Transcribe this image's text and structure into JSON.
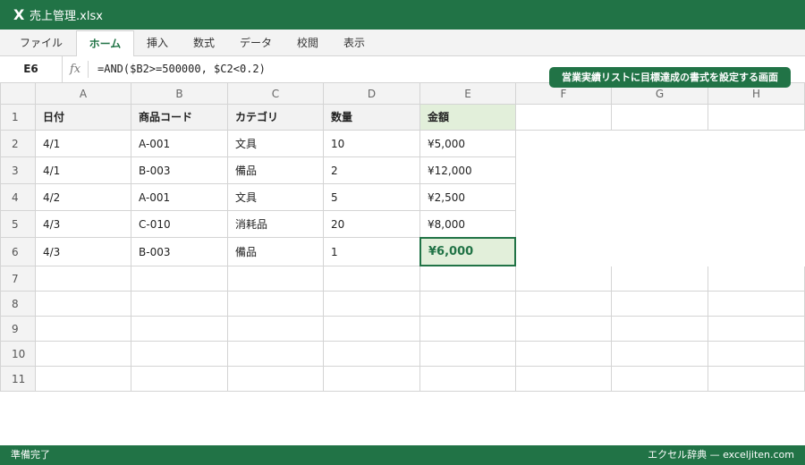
{
  "window": {
    "app_icon": "X",
    "title": "売上管理.xlsx"
  },
  "ribbon": {
    "tabs": [
      {
        "label": "ファイル",
        "active": false
      },
      {
        "label": "ホーム",
        "active": true
      },
      {
        "label": "挿入",
        "active": false
      },
      {
        "label": "数式",
        "active": false
      },
      {
        "label": "データ",
        "active": false
      },
      {
        "label": "校閲",
        "active": false
      },
      {
        "label": "表示",
        "active": false
      }
    ]
  },
  "formula_bar": {
    "name_box": "E6",
    "fx_label": "fx",
    "formula": "=AND($B2>=500000, $C2<0.2)"
  },
  "callout": {
    "text": "営業実績リストに目標達成の書式を設定する画面"
  },
  "grid": {
    "columns": [
      "A",
      "B",
      "C",
      "D",
      "E",
      "F",
      "G",
      "H"
    ],
    "rows": [
      "1",
      "2",
      "3",
      "4",
      "5",
      "6",
      "7",
      "8",
      "9",
      "10",
      "11"
    ],
    "header_row": [
      "日付",
      "商品コード",
      "カテゴリ",
      "数量",
      "金額"
    ],
    "data_rows": [
      [
        "4/1",
        "A-001",
        "文具",
        "10",
        "¥5,000"
      ],
      [
        "4/1",
        "B-003",
        "備品",
        "2",
        "¥12,000"
      ],
      [
        "4/2",
        "A-001",
        "文具",
        "5",
        "¥2,500"
      ],
      [
        "4/3",
        "C-010",
        "消耗品",
        "20",
        "¥8,000"
      ],
      [
        "4/3",
        "B-003",
        "備品",
        "1",
        "¥6,000"
      ]
    ],
    "selected_cell": "E6"
  },
  "colors": {
    "accent": "#217346",
    "highlight_fill": "#e2efda",
    "grid_line": "#d4d4d4"
  },
  "status": {
    "left": "準備完了",
    "right": "エクセル辞典 — exceljiten.com"
  }
}
